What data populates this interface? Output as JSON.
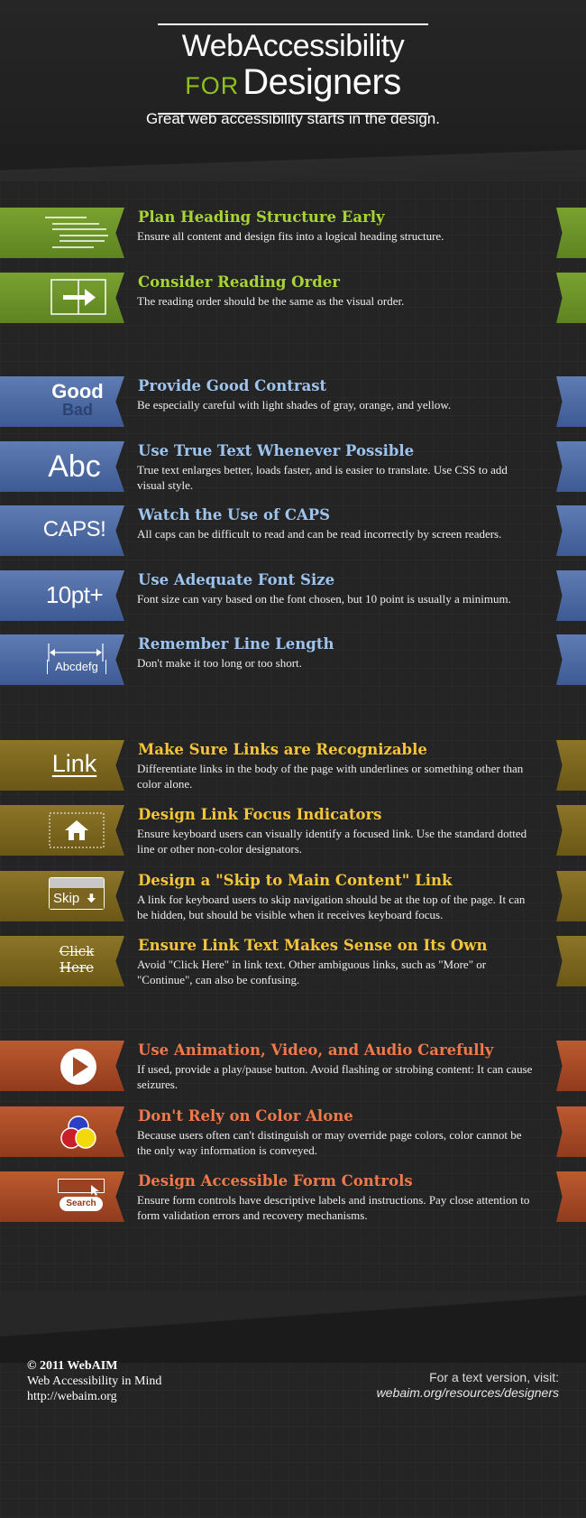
{
  "header": {
    "title_line1": "WebAccessibility",
    "title_for": "FOR",
    "title_designers": "Designers",
    "tagline": "Great web accessibility starts in the design."
  },
  "colors": {
    "green": "#6a9226",
    "blue": "#4a67a2",
    "gold": "#7a6420",
    "red": "#a44a26",
    "green_title": "#a9d435",
    "blue_title": "#9dc4ef",
    "gold_title": "#f4c43a",
    "red_title": "#f0784a"
  },
  "items": [
    {
      "title": "Plan Heading Structure Early",
      "desc": "Ensure all content and design fits into a logical heading structure.",
      "icon": "heading-lines-icon"
    },
    {
      "title": "Consider Reading Order",
      "desc": "The reading order should be the same as the visual order.",
      "icon": "arrow-box-icon"
    },
    {
      "title": "Provide Good Contrast",
      "desc": "Be especially careful with light shades of gray, orange, and yellow.",
      "icon": "contrast-text-icon",
      "icon_text1": "Good",
      "icon_text2": "Bad"
    },
    {
      "title": "Use True Text Whenever Possible",
      "desc": "True text enlarges better, loads faster, and is easier to translate. Use CSS to add visual style.",
      "icon": "abc-icon",
      "icon_text": "Abc"
    },
    {
      "title": "Watch the Use of CAPS",
      "desc": "All caps can be difficult to read and can be read incorrectly by screen readers.",
      "icon": "caps-icon",
      "icon_text": "CAPS!"
    },
    {
      "title": "Use Adequate Font Size",
      "desc": "Font size can vary based on the font chosen, but 10 point is usually a minimum.",
      "icon": "font-size-icon",
      "icon_text": "10pt+"
    },
    {
      "title": "Remember Line Length",
      "desc": "Don't make it too long or too short.",
      "icon": "line-length-icon",
      "icon_text": "Abcdefg"
    },
    {
      "title": "Make Sure Links are Recognizable",
      "desc": "Differentiate links in the body of the page with underlines or something other than color alone.",
      "icon": "link-icon",
      "icon_text": "Link"
    },
    {
      "title": "Design Link Focus Indicators",
      "desc": "Ensure keyboard users can visually identify a focused link.  Use the standard dotted line or other non-color designators.",
      "icon": "home-focus-icon"
    },
    {
      "title": "Design a \"Skip to Main Content\" Link",
      "desc": "A link for keyboard users to skip navigation should be at the top of the page. It can be hidden, but should be visible when it receives keyboard focus.",
      "icon": "skip-icon",
      "icon_text": "Skip"
    },
    {
      "title": "Ensure Link Text Makes Sense on Its Own",
      "desc": "Avoid \"Click Here\" in link text. Other ambiguous links, such as \"More\" or \"Continue\", can also be confusing.",
      "icon": "click-here-icon",
      "icon_text1": "Click",
      "icon_text2": "Here"
    },
    {
      "title": "Use Animation, Video, and Audio Carefully",
      "desc": "If used, provide a play/pause button.  Avoid flashing or strobing content: It can cause seizures.",
      "icon": "play-icon"
    },
    {
      "title": "Don't Rely on Color Alone",
      "desc": "Because users often can't distinguish or may override page colors, color cannot be the only way information is conveyed.",
      "icon": "color-circles-icon"
    },
    {
      "title": "Design Accessible Form Controls",
      "desc": "Ensure form controls have descriptive labels and instructions.  Pay close attention to form validation errors and recovery mechanisms.",
      "icon": "search-form-icon",
      "icon_text": "Search"
    }
  ],
  "footer": {
    "copyright": "© 2011 WebAIM",
    "org": "Web Accessibility in Mind",
    "site": "http://webaim.org",
    "text_version_label": "For a text version, visit:",
    "text_version_url": "webaim.org/resources/designers"
  }
}
